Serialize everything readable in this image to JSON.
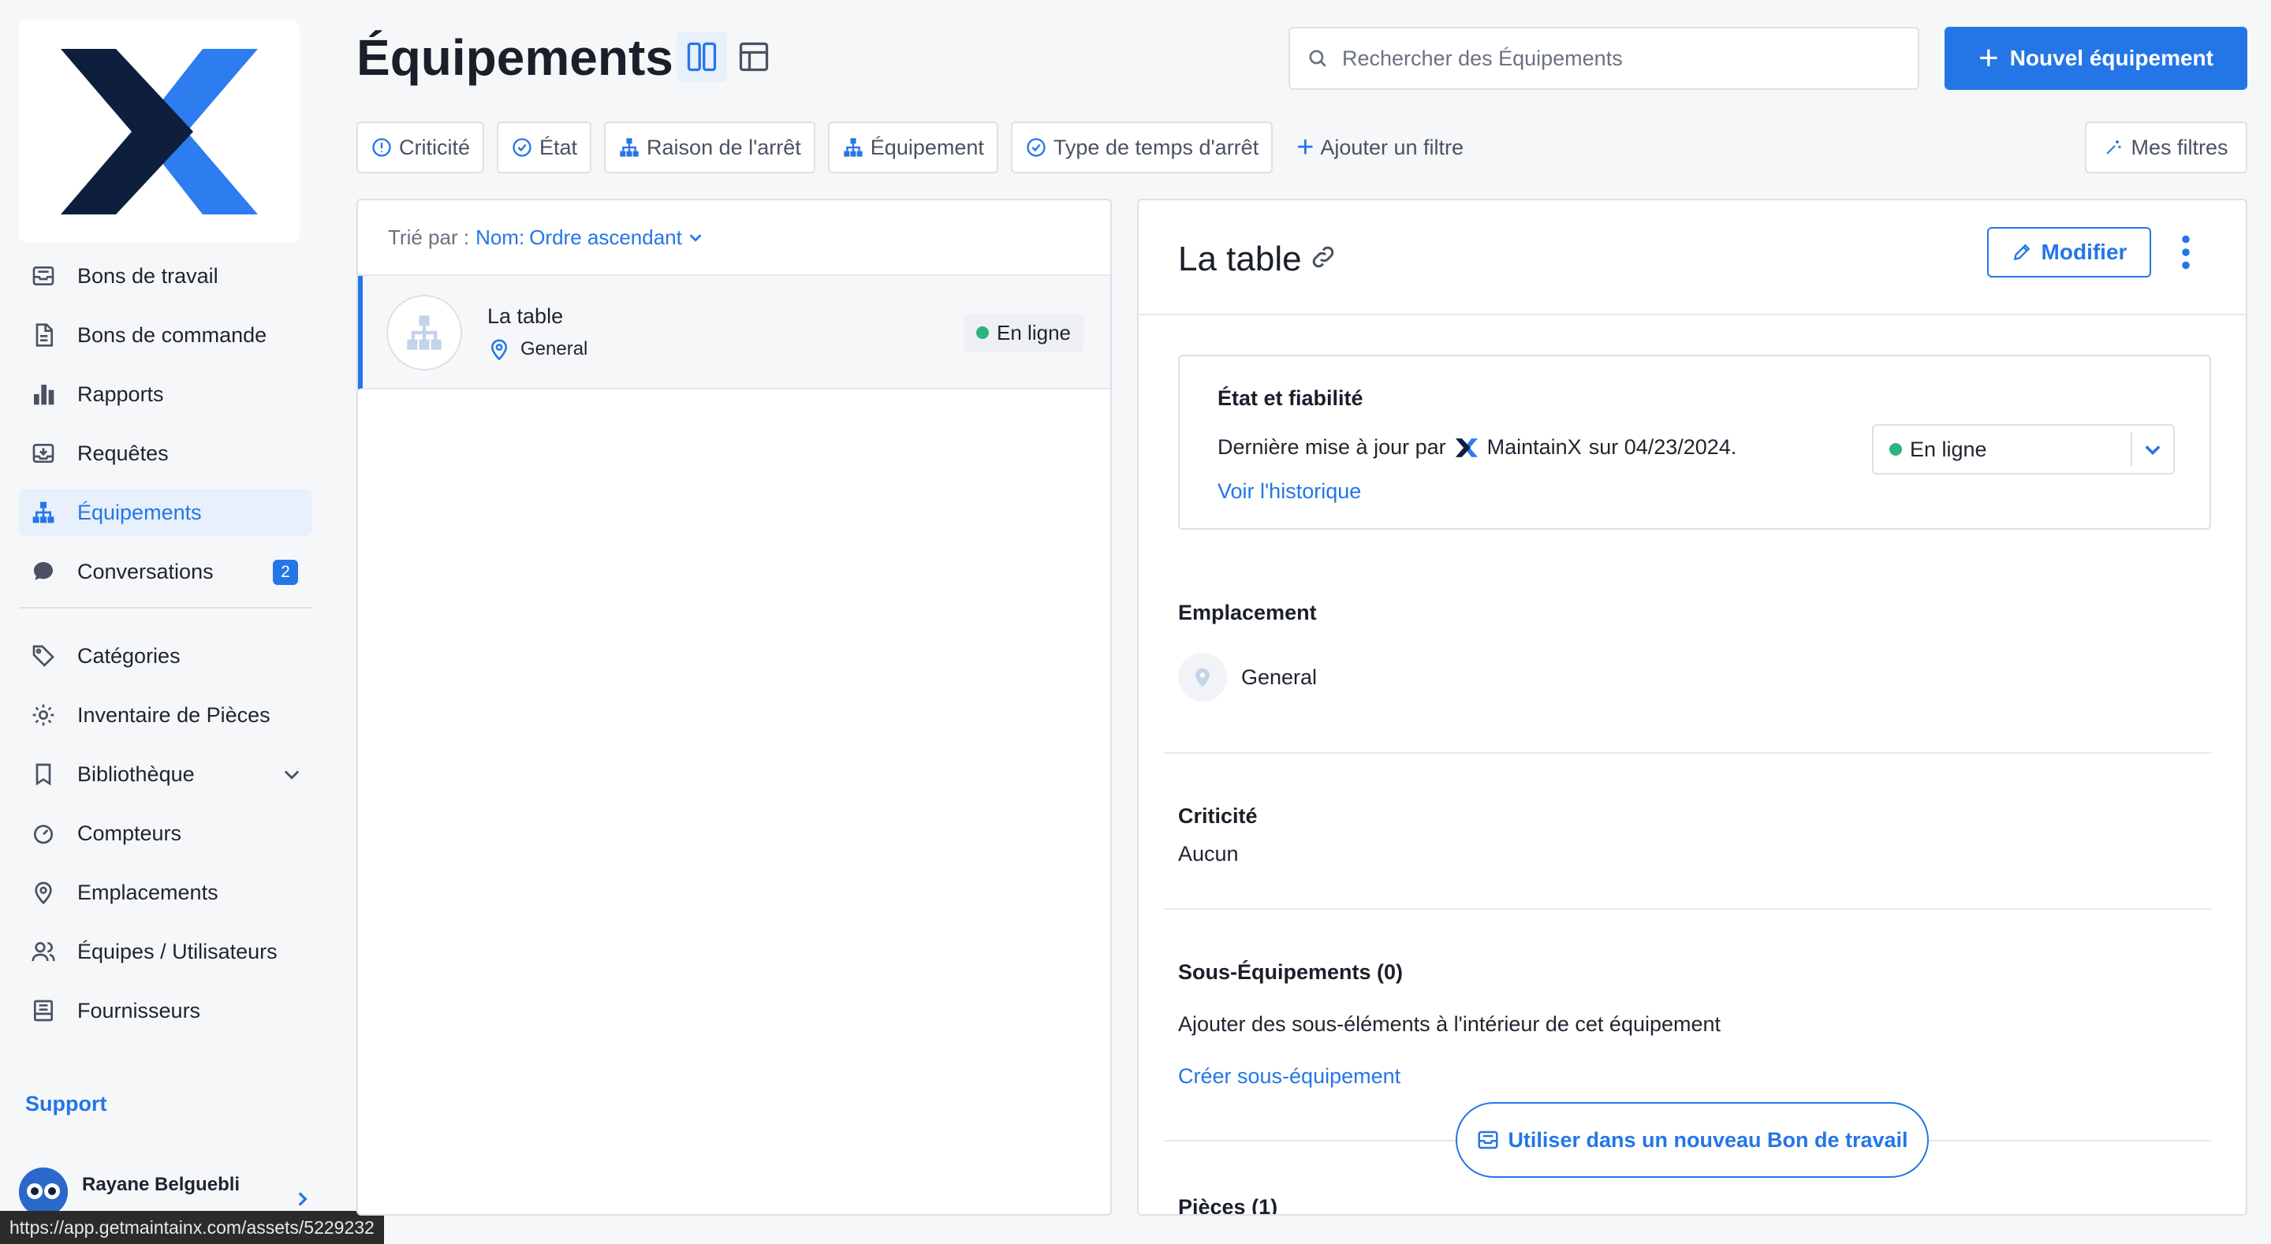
{
  "sidebar": {
    "items": [
      {
        "label": "Bons de travail"
      },
      {
        "label": "Bons de commande"
      },
      {
        "label": "Rapports"
      },
      {
        "label": "Requêtes"
      },
      {
        "label": "Équipements"
      },
      {
        "label": "Conversations",
        "badge": "2"
      },
      {
        "label": "Catégories"
      },
      {
        "label": "Inventaire de Pièces"
      },
      {
        "label": "Bibliothèque"
      },
      {
        "label": "Compteurs"
      },
      {
        "label": "Emplacements"
      },
      {
        "label": "Équipes / Utilisateurs"
      },
      {
        "label": "Fournisseurs"
      }
    ],
    "support_label": "Support",
    "user_name": "Rayane Belguebli"
  },
  "header": {
    "title": "Équipements",
    "search_placeholder": "Rechercher des Équipements",
    "new_button_label": "Nouvel équipement"
  },
  "filters": {
    "items": [
      {
        "label": "Criticité"
      },
      {
        "label": "État"
      },
      {
        "label": "Raison de l'arrêt"
      },
      {
        "label": "Équipement"
      },
      {
        "label": "Type de temps d'arrêt"
      }
    ],
    "add_filter_label": "Ajouter un filtre",
    "my_filters_label": "Mes filtres"
  },
  "list": {
    "sort_prefix": "Trié par :",
    "sort_key": "Nom:",
    "sort_value": "Ordre ascendant",
    "rows": [
      {
        "name": "La table",
        "location": "General",
        "status": "En ligne"
      }
    ]
  },
  "detail": {
    "title": "La table",
    "edit_label": "Modifier",
    "state_title": "État et fiabilité",
    "state_updated_prefix": "Dernière mise à jour par",
    "state_updated_by": "MaintainX",
    "state_updated_suffix": "sur 04/23/2024.",
    "history_link": "Voir l'historique",
    "state_value": "En ligne",
    "location_label": "Emplacement",
    "location_value": "General",
    "criticality_label": "Criticité",
    "criticality_value": "Aucun",
    "sub_label": "Sous-Équipements (0)",
    "sub_text": "Ajouter des sous-éléments à l'intérieur de cet équipement",
    "sub_link": "Créer sous-équipement",
    "use_button": "Utiliser dans un nouveau Bon de travail",
    "parts_label": "Pièces (1)"
  },
  "statusbar": {
    "url": "https://app.getmaintainx.com/assets/5229232"
  },
  "colors": {
    "accent": "#2476e6",
    "online": "#2fb37e",
    "logo_dark": "#0d1f3c"
  }
}
